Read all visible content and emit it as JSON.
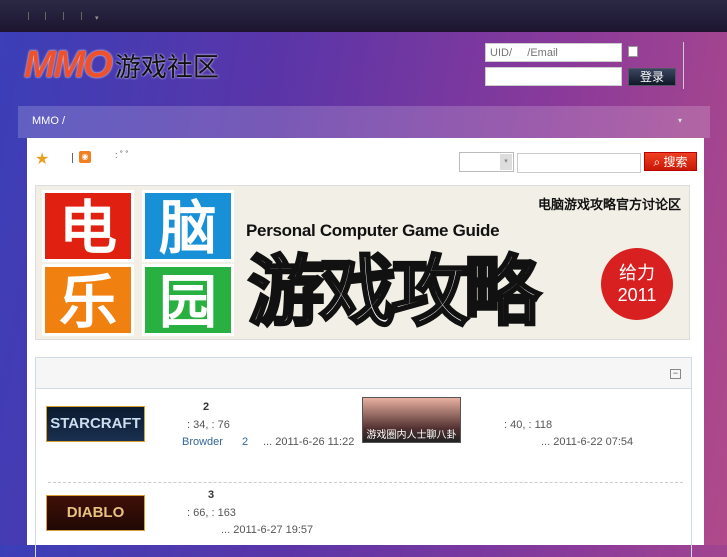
{
  "topbar": {
    "menu_arrow": "▾"
  },
  "header": {
    "logo_text": "MMO",
    "logo_cn": "游戏社区",
    "login": {
      "username_placeholder": "UID/     /Email",
      "password_value": "",
      "login_button": "登录"
    }
  },
  "breadcrumb": {
    "text": "MMO   /",
    "arrow": "▾"
  },
  "toolbar": {
    "star": "★",
    "rss": "◉",
    "dots": ": ˚  ˚",
    "search_button": "搜索",
    "search_icon": "⌕",
    "select_arrow": "▾"
  },
  "banner": {
    "tiles": [
      "电",
      "脑",
      "乐",
      "园"
    ],
    "tagline": "电脑游戏攻略官方讨论区",
    "english": "Personal Computer Game Guide",
    "title": "游戏攻略",
    "badge_line1": "给力",
    "badge_line2": "2011"
  },
  "forum": {
    "collapse": "−",
    "items": [
      {
        "thumb": "STARCRAFT",
        "name": "2",
        "stats": ": 34,   : 76",
        "last_user": "Browder",
        "last_num": "2",
        "last_time": "... 2011-6-26 11:22"
      },
      {
        "thumb": "游戏圈内人士聊八卦",
        "name": "",
        "stats": ": 40,   : 118",
        "last_time": "... 2011-6-22 07:54"
      },
      {
        "thumb": "DIABLO",
        "name": "3",
        "stats": ": 66,   : 163",
        "last_time": "... 2011-6-27 19:57"
      }
    ]
  }
}
